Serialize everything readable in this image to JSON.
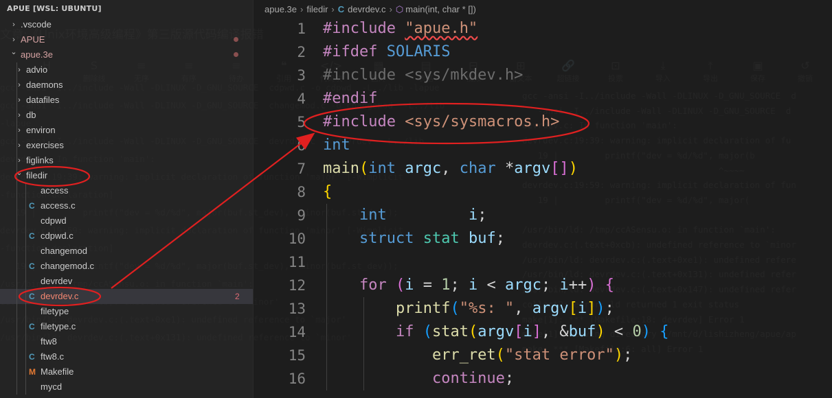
{
  "background": {
    "title_ghost": "文章:《Unix环境高级编程》第三版源代码编译报错",
    "toolbar_ghost": [
      {
        "icon": "H",
        "label": ""
      },
      {
        "icon": "S",
        "label": "删除线"
      },
      {
        "icon": "≡",
        "label": "无序"
      },
      {
        "icon": "≡",
        "label": "有序"
      },
      {
        "icon": "≡",
        "label": "待办"
      },
      {
        "icon": "❝",
        "label": "引用"
      },
      {
        "icon": "</>",
        "label": "代码块"
      },
      {
        "icon": "▦",
        "label": "图片"
      },
      {
        "icon": "▤",
        "label": "表格"
      },
      {
        "icon": "⊟",
        "label": "视频"
      },
      {
        "icon": "⊞",
        "label": "富文本"
      },
      {
        "icon": "🔗",
        "label": "超链接"
      },
      {
        "icon": "⊡",
        "label": "投票"
      },
      {
        "icon": "⤓",
        "label": "导入"
      },
      {
        "icon": "⤒",
        "label": "导出"
      },
      {
        "icon": "▣",
        "label": "保存"
      },
      {
        "icon": "↺",
        "label": "撤销"
      }
    ],
    "left_log": [
      "gcc -ansi -I../include -Wall -DLINUX -D_GNU_SOURCE  cdpwd.c -o cdpwd  -L../lib -lapue",
      "gcc -ansi -I../include -Wall -DLINUX -D_GNU_SOURCE  changemod.c -o changemod  -L../lib",
      "-lapue",
      "gcc -ansi -I../include -Wall -DLINUX -D_GNU_SOURCE  devrdev.c -o devrdev  -L../lib",
      "devrdev.c: In function 'main':",
      "devrdev.c:19:39: warning: implicit declaration of function 'major' [-Wimplicit",
      "-function-declaration]",
      "   19 |         printf(\"dev = %d/%d\", major(buf.st_dev),  minor(buf.st_dev));",
      "devrdev.c:19:59: warning: implicit declaration of function 'minor' [-Wimplicit",
      "-function-declaration]",
      "   19 |         printf(\"dev = %d/%d\", major(buf.st_dev),  minor(buf.st_dev));",
      "/usr/bin/ld: /tmp/ccASensu.o: in function `main':",
      "devrdev.c:(.text+0xcb): undefined reference to `minor'",
      "/usr/bin/ld: devrdev.c:(.text+0xe1): undefined reference to `major'",
      "/usr/bin/ld: devrdev.c:(.text+0x131): undefined reference to `minor'"
    ],
    "right_log": [
      "gcc -ansi -I../include -Wall -DLINUX -D_GNU_SOURCE  d",
      "   -ansi -I../include -Wall -DLINUX -D_GNU_SOURCE  d",
      "devrdev.c: In function 'main':",
      "devrdev.c:19:39: warning: implicit declaration of fu",
      "   19 |         printf(\"dev = %d/%d\", major(b",
      "                                      ^~~~~",
      "devrdev.c:19:59: warning: implicit declaration of fun",
      "   19 |         printf(\"dev = %d/%d\", major(",
      "",
      "/usr/bin/ld: /tmp/ccASensu.o: in function `main':",
      "devrdev.c:(.text+0xcb): undefined reference to `minor",
      "/usr/bin/ld: devrdev.c:(.text+0xe1): undefined refere",
      "/usr/bin/ld: devrdev.c:(.text+0x131): undefined refer",
      "/usr/bin/ld: devrdev.c:(.text+0x147): undefined refer",
      "collect2: error: ld returned 1 exit status",
      "make[1]: *** [Makefile:18: devrdev] Error 1",
      "make[1]: Leaving directory '/mnt/d/lishizheng/apue/ap",
      "make: *** [Makefile:6: all] Error 1"
    ]
  },
  "sidebar": {
    "header": "APUE [WSL: UBUNTU]",
    "items": [
      {
        "label": ".vscode",
        "type": "folder",
        "state": "collapsed",
        "depth": 0
      },
      {
        "label": "APUE",
        "type": "folder",
        "state": "collapsed",
        "depth": 0,
        "modified": true
      },
      {
        "label": "apue.3e",
        "type": "folder",
        "state": "expanded",
        "depth": 0,
        "modified": true
      },
      {
        "label": "advio",
        "type": "folder",
        "state": "collapsed",
        "depth": 1
      },
      {
        "label": "daemons",
        "type": "folder",
        "state": "collapsed",
        "depth": 1
      },
      {
        "label": "datafiles",
        "type": "folder",
        "state": "collapsed",
        "depth": 1
      },
      {
        "label": "db",
        "type": "folder",
        "state": "collapsed",
        "depth": 1
      },
      {
        "label": "environ",
        "type": "folder",
        "state": "collapsed",
        "depth": 1
      },
      {
        "label": "exercises",
        "type": "folder",
        "state": "collapsed",
        "depth": 1
      },
      {
        "label": "figlinks",
        "type": "folder",
        "state": "collapsed",
        "depth": 1
      },
      {
        "label": "filedir",
        "type": "folder",
        "state": "expanded",
        "depth": 1
      },
      {
        "label": "access",
        "type": "file",
        "depth": 2
      },
      {
        "label": "access.c",
        "type": "c",
        "depth": 2
      },
      {
        "label": "cdpwd",
        "type": "file",
        "depth": 2
      },
      {
        "label": "cdpwd.c",
        "type": "c",
        "depth": 2
      },
      {
        "label": "changemod",
        "type": "file",
        "depth": 2
      },
      {
        "label": "changemod.c",
        "type": "c",
        "depth": 2
      },
      {
        "label": "devrdev",
        "type": "file",
        "depth": 2
      },
      {
        "label": "devrdev.c",
        "type": "c",
        "depth": 2,
        "selected": true,
        "badge": "2"
      },
      {
        "label": "filetype",
        "type": "file",
        "depth": 2
      },
      {
        "label": "filetype.c",
        "type": "c",
        "depth": 2
      },
      {
        "label": "ftw8",
        "type": "file",
        "depth": 2
      },
      {
        "label": "ftw8.c",
        "type": "c",
        "depth": 2
      },
      {
        "label": "Makefile",
        "type": "makefile",
        "depth": 2
      },
      {
        "label": "mycd",
        "type": "file",
        "depth": 2
      }
    ]
  },
  "editor": {
    "breadcrumb": {
      "parts": [
        "apue.3e",
        "filedir",
        "devrdev.c"
      ],
      "symbol": "main(int, char * [])",
      "c_icon": "C"
    },
    "line_numbers": [
      "1",
      "2",
      "3",
      "4",
      "5",
      "6",
      "7",
      "8",
      "9",
      "10",
      "11",
      "12",
      "13",
      "14",
      "15",
      "16"
    ],
    "lines": [
      "#include \"apue.h\"",
      "#ifdef SOLARIS",
      "#include <sys/mkdev.h>",
      "#endif",
      "#include <sys/sysmacros.h>",
      "int",
      "main(int argc, char *argv[])",
      "{",
      "    int         i;",
      "    struct stat buf;",
      "",
      "    for (i = 1; i < argc; i++) {",
      "        printf(\"%s: \", argv[i]);",
      "        if (stat(argv[i], &buf) < 0) {",
      "            err_ret(\"stat error\");",
      "            continue;"
    ]
  },
  "annotations": {
    "color": "#e02020"
  }
}
